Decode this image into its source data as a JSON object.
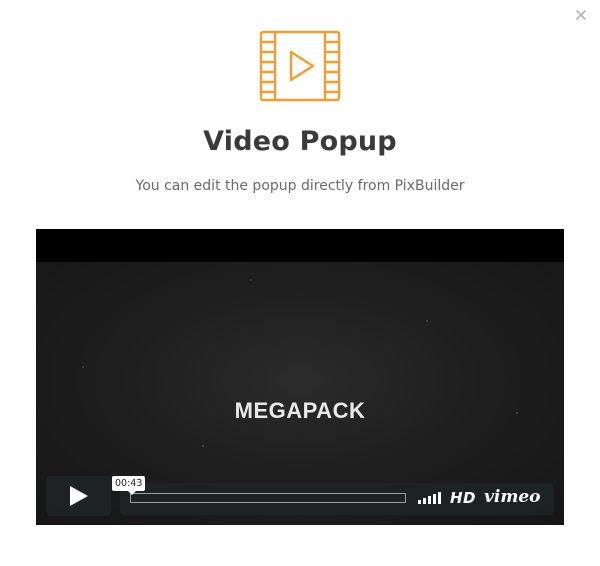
{
  "popup": {
    "title": "Video Popup",
    "subtitle": "You can edit the popup directly from PixBuilder",
    "accent_color": "#f39c32",
    "close_icon": "close-icon",
    "hero_icon": "film-play-icon"
  },
  "video": {
    "frame_text": "MEGAPACK",
    "current_time": "00:43",
    "hd_label": "HD",
    "brand_label": "vimeo",
    "play_icon": "play-icon",
    "volume_icon": "volume-bars-icon"
  }
}
